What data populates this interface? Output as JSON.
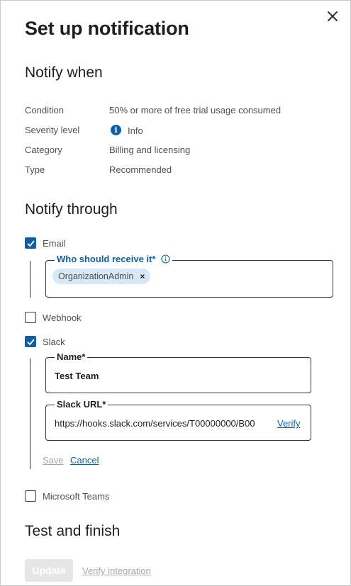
{
  "panel": {
    "title": "Set up notification",
    "close_icon": "close-icon"
  },
  "notify_when": {
    "heading": "Notify when",
    "rows": [
      {
        "label": "Condition",
        "value": "50% or more of free trial usage consumed"
      },
      {
        "label": "Severity level",
        "value": "Info",
        "icon": "info-icon"
      },
      {
        "label": "Category",
        "value": "Billing and licensing"
      },
      {
        "label": "Type",
        "value": "Recommended"
      }
    ],
    "info_icon_glyph": "i"
  },
  "notify_through": {
    "heading": "Notify through",
    "email": {
      "label": "Email",
      "checked": true,
      "recipient_field_label": "Who should receive it*",
      "chips": [
        "OrganizationAdmin"
      ],
      "chip_remove_glyph": "×"
    },
    "webhook": {
      "label": "Webhook",
      "checked": false
    },
    "slack": {
      "label": "Slack",
      "checked": true,
      "name_label": "Name*",
      "name_value": "Test Team",
      "url_label": "Slack URL*",
      "url_value": "https://hooks.slack.com/services/T00000000/B00",
      "verify_label": "Verify",
      "save_label": "Save",
      "cancel_label": "Cancel"
    },
    "teams": {
      "label": "Microsoft Teams",
      "checked": false
    }
  },
  "test_and_finish": {
    "heading": "Test and finish",
    "update_label": "Update",
    "verify_integration_label": "Verify integration"
  },
  "colors": {
    "accent": "#0f5fa8",
    "chip_bg": "#d7e9f6",
    "disabled_text": "#a7a7a7"
  }
}
